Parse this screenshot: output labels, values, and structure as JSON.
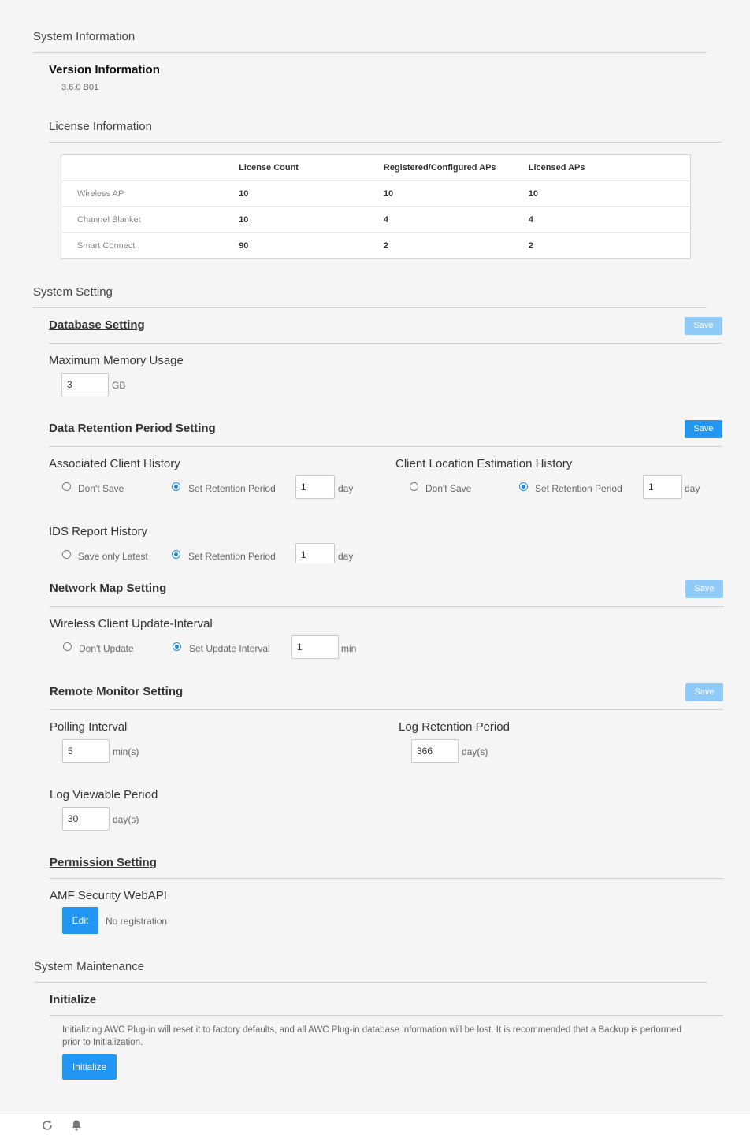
{
  "system_information": {
    "title": "System Information",
    "version": {
      "title": "Version Information",
      "value": "3.6.0 B01"
    },
    "license": {
      "title": "License Information",
      "columns": [
        "",
        "License Count",
        "Registered/Configured APs",
        "Licensed APs"
      ],
      "rows": [
        {
          "name": "Wireless AP",
          "license_count": "10",
          "registered": "10",
          "licensed": "10"
        },
        {
          "name": "Channel Blanket",
          "license_count": "10",
          "registered": "4",
          "licensed": "4"
        },
        {
          "name": "Smart Connect",
          "license_count": "90",
          "registered": "2",
          "licensed": "2"
        }
      ]
    }
  },
  "system_setting": {
    "title": "System Setting",
    "database": {
      "title": "Database Setting",
      "save_label": "Save",
      "max_memory": {
        "label": "Maximum Memory Usage",
        "value": "3",
        "unit": "GB"
      }
    },
    "data_retention": {
      "title": "Data Retention Period Setting",
      "save_label": "Save",
      "associated_client": {
        "label": "Associated Client History",
        "option_off": "Don't Save",
        "option_on": "Set Retention Period",
        "selected": "on",
        "value": "1",
        "unit": "day"
      },
      "client_location": {
        "label": "Client Location Estimation History",
        "option_off": "Don't Save",
        "option_on": "Set Retention Period",
        "selected": "on",
        "value": "1",
        "unit": "day"
      },
      "ids_report": {
        "label": "IDS Report History",
        "option_off": "Save only Latest",
        "option_on": "Set Retention Period",
        "selected": "on",
        "value": "1",
        "unit": "day"
      }
    },
    "network_map": {
      "title": "Network Map Setting",
      "save_label": "Save",
      "wireless_client": {
        "label": "Wireless Client Update-Interval",
        "option_off": "Don't Update",
        "option_on": "Set Update Interval",
        "selected": "on",
        "value": "1",
        "unit": "min"
      }
    },
    "remote_monitor": {
      "title": "Remote Monitor Setting",
      "save_label": "Save",
      "polling_interval": {
        "label": "Polling Interval",
        "value": "5",
        "unit": "min(s)"
      },
      "log_retention": {
        "label": "Log Retention Period",
        "value": "366",
        "unit": "day(s)"
      },
      "log_viewable": {
        "label": "Log Viewable Period",
        "value": "30",
        "unit": "day(s)"
      }
    },
    "permission": {
      "title": "Permission Setting",
      "webapi": {
        "label": "AMF Security WebAPI",
        "edit_label": "Edit",
        "status": "No registration"
      }
    }
  },
  "system_maintenance": {
    "title": "System Maintenance",
    "initialize": {
      "title": "Initialize",
      "description_line1": "Initializing AWC Plug-in will reset it to factory defaults, and all AWC Plug-in database information will be lost. It is recommended that a Backup is performed",
      "description_line2": "prior to Initialization.",
      "button_label": "Initialize"
    }
  },
  "footer": {
    "icons": [
      "refresh-icon",
      "bell-icon"
    ]
  },
  "colors": {
    "primary": "#2196f3",
    "primary_disabled": "#90caf9",
    "background": "#f5f5f5"
  }
}
